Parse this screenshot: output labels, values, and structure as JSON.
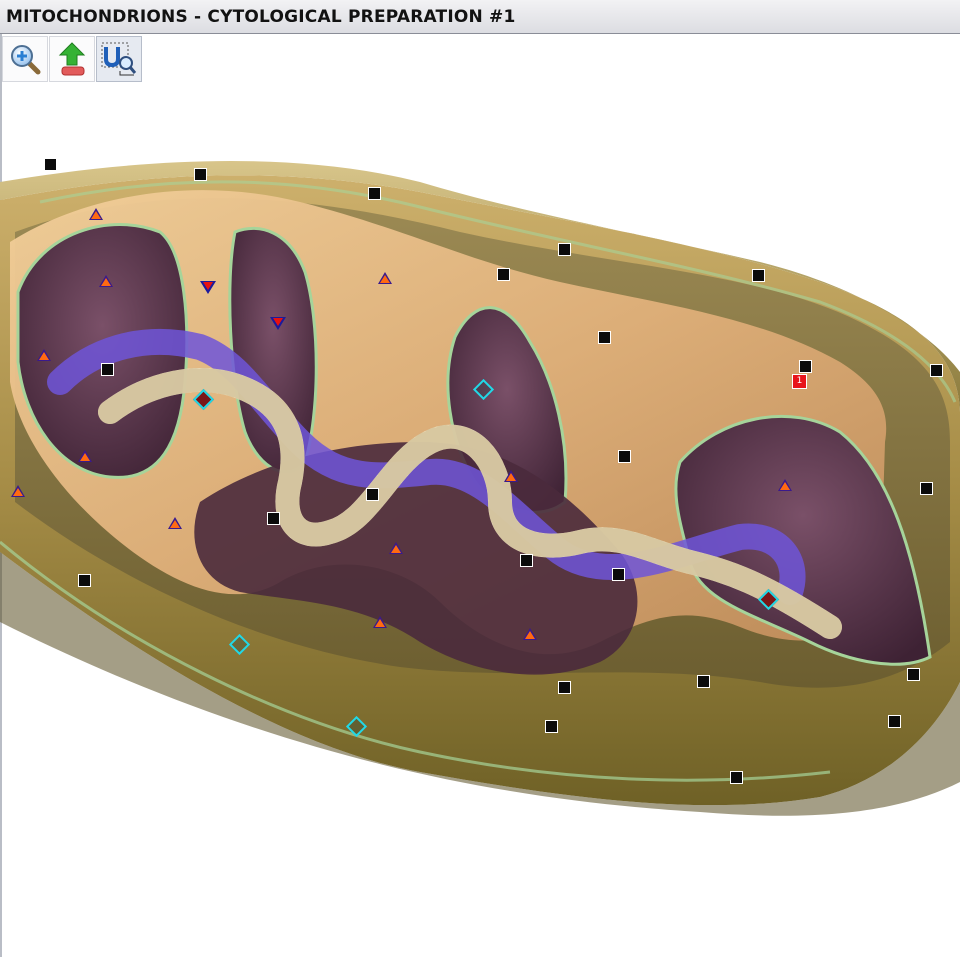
{
  "window": {
    "title": "MITOCHONDRIONS - CYTOLOGICAL PREPARATION #1"
  },
  "toolbar": {
    "tools": [
      {
        "icon": "zoom-in-magnifier-icon"
      },
      {
        "icon": "upload-arrow-icon"
      },
      {
        "icon": "select-region-icon",
        "active": true
      }
    ]
  },
  "viewer": {
    "image": "mitochondrion-cutaway-illustration",
    "labels": [
      {
        "text": "1",
        "color": "#e8141a"
      }
    ],
    "marker_colors": {
      "square": "#0b0b0b",
      "triangle": "#ff6a12",
      "triangle_outline": "#3a1a8c",
      "triangle_down": "#e8120f",
      "diamond_fill": "#7a1618",
      "diamond_outline": "#22d8e6"
    }
  }
}
